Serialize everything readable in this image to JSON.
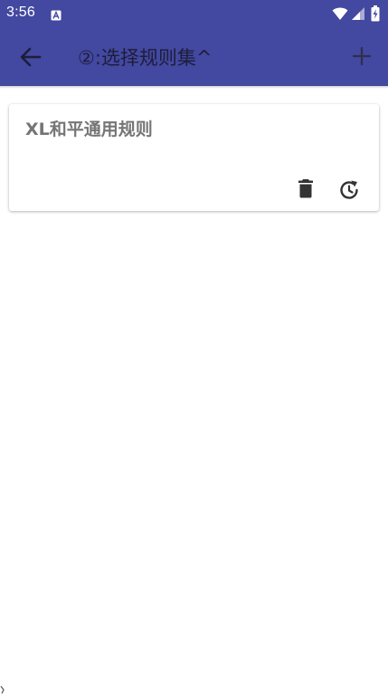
{
  "status_bar": {
    "time": "3:56",
    "notification_icon": "a-notification-icon",
    "wifi_icon": "wifi-icon",
    "signal_icon": "signal-icon",
    "battery_icon": "battery-charging-icon"
  },
  "app_bar": {
    "title": "②:选择规则集^",
    "back_icon": "arrow-back-icon",
    "add_icon": "plus-icon"
  },
  "rule_sets": [
    {
      "name": "XL和平通用规则",
      "actions": [
        "delete-icon",
        "restore-icon"
      ]
    }
  ],
  "colors": {
    "primary": "#4348a0",
    "title_text": "#1d1d3a",
    "card_title": "#757575",
    "icon_dark": "#333333",
    "background": "#ffffff"
  }
}
